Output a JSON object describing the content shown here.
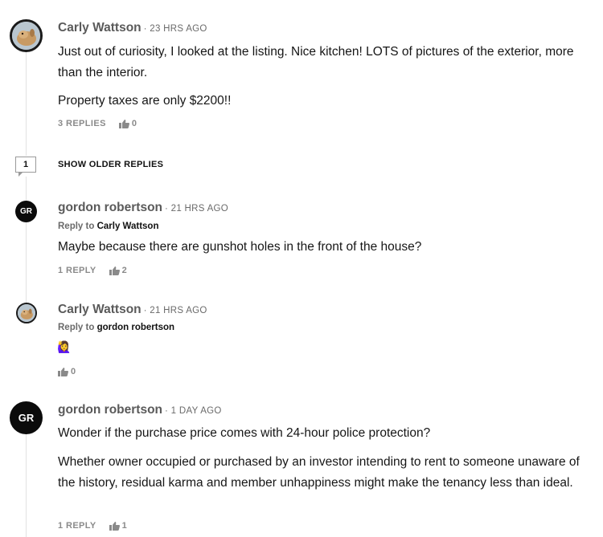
{
  "comments": [
    {
      "author": "Carly Wattson",
      "time": "· 23 HRS AGO",
      "paragraphs": [
        "Just out of curiosity, I looked at the listing. Nice kitchen! LOTS of pictures of the exterior, more than the interior.",
        "Property taxes are only $2200!!"
      ],
      "replies_label": "3 REPLIES",
      "likes": "0"
    },
    {
      "author": "gordon robertson",
      "initials": "GR",
      "time": "· 21 HRS AGO",
      "reply_to_prefix": "Reply to",
      "reply_to_name": "Carly Wattson",
      "paragraphs": [
        "Maybe because there are gunshot holes in the front of the house?"
      ],
      "replies_label": "1 REPLY",
      "likes": "2"
    },
    {
      "author": "Carly Wattson",
      "time": "· 21 HRS AGO",
      "reply_to_prefix": "Reply to",
      "reply_to_name": "gordon robertson",
      "emoji": "🙋‍♀️",
      "likes": "0"
    },
    {
      "author": "gordon robertson",
      "initials": "GR",
      "time": "· 1 DAY AGO",
      "paragraphs": [
        "Wonder if the purchase price comes with 24-hour police protection?",
        "Whether owner occupied or purchased by an investor intending to rent to someone unaware of the history, residual karma and member unhappiness might make the tenancy less than ideal."
      ],
      "replies_label": "1 REPLY",
      "likes": "1"
    }
  ],
  "older_replies": {
    "count": "1",
    "label": "SHOW OLDER REPLIES"
  }
}
